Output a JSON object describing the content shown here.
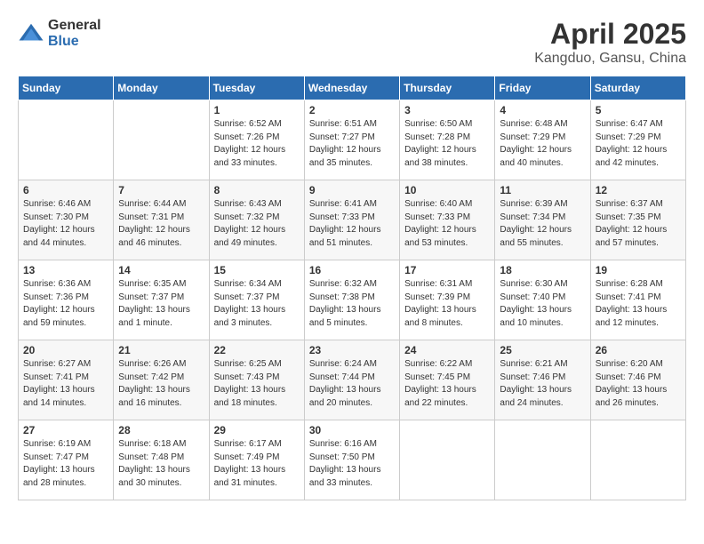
{
  "header": {
    "logo_general": "General",
    "logo_blue": "Blue",
    "title": "April 2025",
    "subtitle": "Kangduo, Gansu, China"
  },
  "weekdays": [
    "Sunday",
    "Monday",
    "Tuesday",
    "Wednesday",
    "Thursday",
    "Friday",
    "Saturday"
  ],
  "weeks": [
    [
      {
        "num": "",
        "sunrise": "",
        "sunset": "",
        "daylight": ""
      },
      {
        "num": "",
        "sunrise": "",
        "sunset": "",
        "daylight": ""
      },
      {
        "num": "1",
        "sunrise": "Sunrise: 6:52 AM",
        "sunset": "Sunset: 7:26 PM",
        "daylight": "Daylight: 12 hours and 33 minutes."
      },
      {
        "num": "2",
        "sunrise": "Sunrise: 6:51 AM",
        "sunset": "Sunset: 7:27 PM",
        "daylight": "Daylight: 12 hours and 35 minutes."
      },
      {
        "num": "3",
        "sunrise": "Sunrise: 6:50 AM",
        "sunset": "Sunset: 7:28 PM",
        "daylight": "Daylight: 12 hours and 38 minutes."
      },
      {
        "num": "4",
        "sunrise": "Sunrise: 6:48 AM",
        "sunset": "Sunset: 7:29 PM",
        "daylight": "Daylight: 12 hours and 40 minutes."
      },
      {
        "num": "5",
        "sunrise": "Sunrise: 6:47 AM",
        "sunset": "Sunset: 7:29 PM",
        "daylight": "Daylight: 12 hours and 42 minutes."
      }
    ],
    [
      {
        "num": "6",
        "sunrise": "Sunrise: 6:46 AM",
        "sunset": "Sunset: 7:30 PM",
        "daylight": "Daylight: 12 hours and 44 minutes."
      },
      {
        "num": "7",
        "sunrise": "Sunrise: 6:44 AM",
        "sunset": "Sunset: 7:31 PM",
        "daylight": "Daylight: 12 hours and 46 minutes."
      },
      {
        "num": "8",
        "sunrise": "Sunrise: 6:43 AM",
        "sunset": "Sunset: 7:32 PM",
        "daylight": "Daylight: 12 hours and 49 minutes."
      },
      {
        "num": "9",
        "sunrise": "Sunrise: 6:41 AM",
        "sunset": "Sunset: 7:33 PM",
        "daylight": "Daylight: 12 hours and 51 minutes."
      },
      {
        "num": "10",
        "sunrise": "Sunrise: 6:40 AM",
        "sunset": "Sunset: 7:33 PM",
        "daylight": "Daylight: 12 hours and 53 minutes."
      },
      {
        "num": "11",
        "sunrise": "Sunrise: 6:39 AM",
        "sunset": "Sunset: 7:34 PM",
        "daylight": "Daylight: 12 hours and 55 minutes."
      },
      {
        "num": "12",
        "sunrise": "Sunrise: 6:37 AM",
        "sunset": "Sunset: 7:35 PM",
        "daylight": "Daylight: 12 hours and 57 minutes."
      }
    ],
    [
      {
        "num": "13",
        "sunrise": "Sunrise: 6:36 AM",
        "sunset": "Sunset: 7:36 PM",
        "daylight": "Daylight: 12 hours and 59 minutes."
      },
      {
        "num": "14",
        "sunrise": "Sunrise: 6:35 AM",
        "sunset": "Sunset: 7:37 PM",
        "daylight": "Daylight: 13 hours and 1 minute."
      },
      {
        "num": "15",
        "sunrise": "Sunrise: 6:34 AM",
        "sunset": "Sunset: 7:37 PM",
        "daylight": "Daylight: 13 hours and 3 minutes."
      },
      {
        "num": "16",
        "sunrise": "Sunrise: 6:32 AM",
        "sunset": "Sunset: 7:38 PM",
        "daylight": "Daylight: 13 hours and 5 minutes."
      },
      {
        "num": "17",
        "sunrise": "Sunrise: 6:31 AM",
        "sunset": "Sunset: 7:39 PM",
        "daylight": "Daylight: 13 hours and 8 minutes."
      },
      {
        "num": "18",
        "sunrise": "Sunrise: 6:30 AM",
        "sunset": "Sunset: 7:40 PM",
        "daylight": "Daylight: 13 hours and 10 minutes."
      },
      {
        "num": "19",
        "sunrise": "Sunrise: 6:28 AM",
        "sunset": "Sunset: 7:41 PM",
        "daylight": "Daylight: 13 hours and 12 minutes."
      }
    ],
    [
      {
        "num": "20",
        "sunrise": "Sunrise: 6:27 AM",
        "sunset": "Sunset: 7:41 PM",
        "daylight": "Daylight: 13 hours and 14 minutes."
      },
      {
        "num": "21",
        "sunrise": "Sunrise: 6:26 AM",
        "sunset": "Sunset: 7:42 PM",
        "daylight": "Daylight: 13 hours and 16 minutes."
      },
      {
        "num": "22",
        "sunrise": "Sunrise: 6:25 AM",
        "sunset": "Sunset: 7:43 PM",
        "daylight": "Daylight: 13 hours and 18 minutes."
      },
      {
        "num": "23",
        "sunrise": "Sunrise: 6:24 AM",
        "sunset": "Sunset: 7:44 PM",
        "daylight": "Daylight: 13 hours and 20 minutes."
      },
      {
        "num": "24",
        "sunrise": "Sunrise: 6:22 AM",
        "sunset": "Sunset: 7:45 PM",
        "daylight": "Daylight: 13 hours and 22 minutes."
      },
      {
        "num": "25",
        "sunrise": "Sunrise: 6:21 AM",
        "sunset": "Sunset: 7:46 PM",
        "daylight": "Daylight: 13 hours and 24 minutes."
      },
      {
        "num": "26",
        "sunrise": "Sunrise: 6:20 AM",
        "sunset": "Sunset: 7:46 PM",
        "daylight": "Daylight: 13 hours and 26 minutes."
      }
    ],
    [
      {
        "num": "27",
        "sunrise": "Sunrise: 6:19 AM",
        "sunset": "Sunset: 7:47 PM",
        "daylight": "Daylight: 13 hours and 28 minutes."
      },
      {
        "num": "28",
        "sunrise": "Sunrise: 6:18 AM",
        "sunset": "Sunset: 7:48 PM",
        "daylight": "Daylight: 13 hours and 30 minutes."
      },
      {
        "num": "29",
        "sunrise": "Sunrise: 6:17 AM",
        "sunset": "Sunset: 7:49 PM",
        "daylight": "Daylight: 13 hours and 31 minutes."
      },
      {
        "num": "30",
        "sunrise": "Sunrise: 6:16 AM",
        "sunset": "Sunset: 7:50 PM",
        "daylight": "Daylight: 13 hours and 33 minutes."
      },
      {
        "num": "",
        "sunrise": "",
        "sunset": "",
        "daylight": ""
      },
      {
        "num": "",
        "sunrise": "",
        "sunset": "",
        "daylight": ""
      },
      {
        "num": "",
        "sunrise": "",
        "sunset": "",
        "daylight": ""
      }
    ]
  ]
}
